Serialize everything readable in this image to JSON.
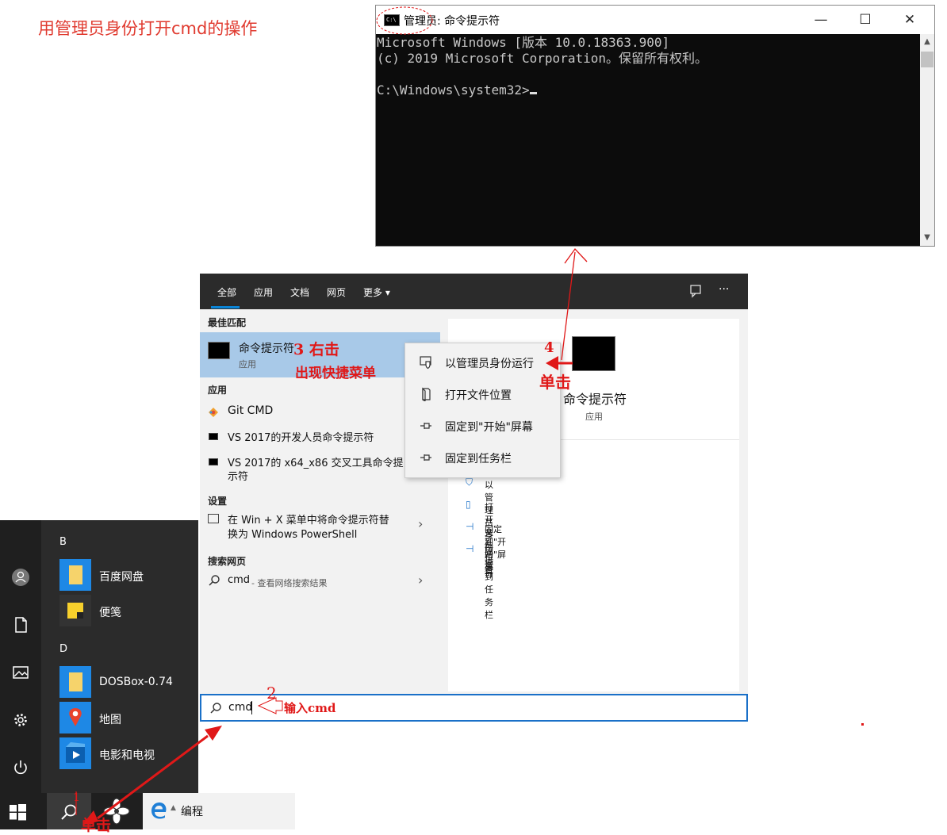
{
  "page_note": "用管理员身份打开cmd的操作",
  "cmd_window": {
    "title": "管理员: 命令提示符",
    "icon_text": "C:\\",
    "lines": [
      "Microsoft Windows [版本 10.0.18363.900]",
      "(c) 2019 Microsoft Corporation。保留所有权利。",
      "",
      "C:\\Windows\\system32>"
    ],
    "controls": {
      "minimize": "—",
      "maximize": "☐",
      "close": "✕"
    }
  },
  "search_panel": {
    "tabs": [
      "全部",
      "应用",
      "文档",
      "网页",
      "更多 ▾"
    ],
    "header_icons": [
      "feedback-icon",
      "more-icon"
    ],
    "header_more": "···",
    "best_match_header": "最佳匹配",
    "best_match": {
      "title": "命令提示符",
      "subtitle": "应用"
    },
    "apps_header": "应用",
    "apps": [
      {
        "label": "Git CMD"
      },
      {
        "label": "VS 2017的开发人员命令提示符"
      },
      {
        "label": "VS 2017的 x64_x86 交叉工具命令提示符",
        "line1": "VS 2017的 x64_x86 交叉工具命令提",
        "line2": "示符"
      }
    ],
    "settings_header": "设置",
    "setting_item": {
      "line1": "在 Win + X 菜单中将命令提示符替",
      "line2": "换为 Windows PowerShell"
    },
    "web_header": "搜索网页",
    "web_item": {
      "query": "cmd",
      "suffix": "- 查看网络搜索结果"
    },
    "search_value": "cmd",
    "preview": {
      "title": "命令提示符",
      "subtitle": "应用"
    },
    "preview_actions": [
      "以管理员身份运行",
      "打开文件位置",
      "固定到\"开始\"屏幕",
      "固定到任务栏"
    ]
  },
  "context_menu": {
    "items": [
      {
        "label": "以管理员身份运行",
        "icon": "shield-icon"
      },
      {
        "label": "打开文件位置",
        "icon": "file-location-icon"
      },
      {
        "label": "固定到\"开始\"屏幕",
        "icon": "pin-icon"
      },
      {
        "label": "固定到任务栏",
        "icon": "pin-icon"
      }
    ]
  },
  "start_menu": {
    "groups": [
      {
        "letter": "B",
        "apps": [
          {
            "label": "百度网盘",
            "color": "#1e88e5"
          },
          {
            "label": "便笺",
            "color": "#333333"
          }
        ]
      },
      {
        "letter": "D",
        "apps": [
          {
            "label": "DOSBox-0.74",
            "color": "#1e88e5"
          },
          {
            "label": "地图",
            "color": "#1e88e5"
          },
          {
            "label": "电影和电视",
            "color": "#1e88e5"
          }
        ]
      }
    ],
    "rail_icons": [
      "user-icon",
      "document-icon",
      "pictures-icon",
      "settings-icon",
      "power-icon"
    ]
  },
  "taskbar": {
    "pinned_label": "编程"
  },
  "annotations": {
    "step1": "1",
    "step1_text": "单击",
    "step2": "2",
    "step2_text": "输入cmd",
    "step3_line1": "3  右击",
    "step3_line2": "出现快捷菜单",
    "step4": "4",
    "step4_text": "单击"
  },
  "colors": {
    "annotation": "#e01818",
    "accent": "#1a70c8",
    "selected": "#a8c9e8"
  }
}
